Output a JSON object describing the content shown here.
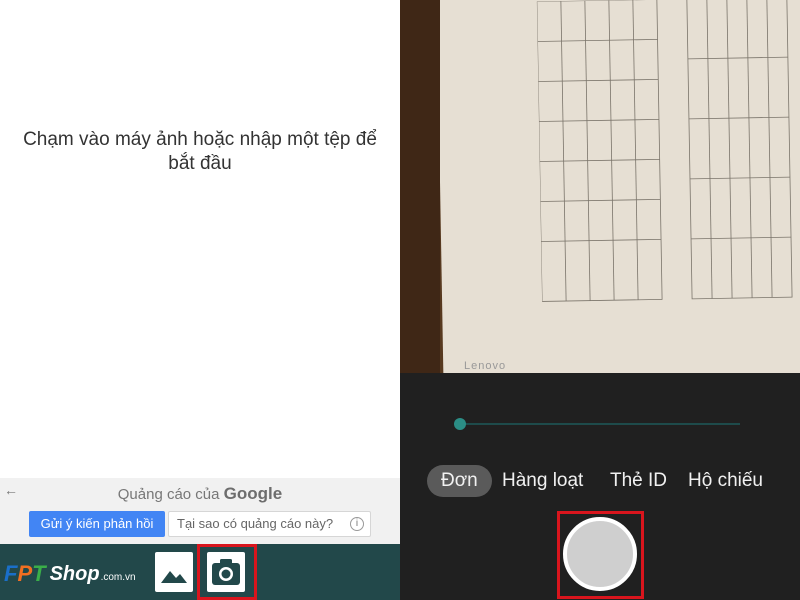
{
  "left": {
    "prompt": "Chạm vào máy ảnh hoặc nhập một tệp để bắt đầu",
    "ad": {
      "back_glyph": "←",
      "title_prefix": "Quảng cáo của",
      "title_brand": "Google",
      "feedback_button": "Gửi ý kiến phản hồi",
      "why_button": "Tại sao có quảng cáo này?",
      "info_glyph": "i"
    },
    "bottom_bar": {
      "brand_letters": [
        "F",
        "P",
        "T"
      ],
      "brand_shop": "Shop",
      "brand_domain": ".com.vn",
      "gallery_icon": "image-icon",
      "camera_icon": "camera-icon"
    }
  },
  "right": {
    "viewfinder_watermark": "Lenovo",
    "zoom_level": 0,
    "modes": [
      {
        "label": "Đơn",
        "active": true
      },
      {
        "label": "Hàng loạt",
        "active": false
      },
      {
        "label": "Thẻ ID",
        "active": false
      },
      {
        "label": "Hộ chiếu",
        "active": false
      }
    ],
    "shutter_icon": "shutter-button"
  },
  "colors": {
    "accent_blue": "#4285f4",
    "bottom_bar": "#22484a",
    "highlight_red": "#d9151d",
    "slider_teal": "#2b8d85",
    "fpt_blue": "#1a6fc9",
    "fpt_orange": "#f26f21",
    "fpt_green": "#3aae49"
  }
}
